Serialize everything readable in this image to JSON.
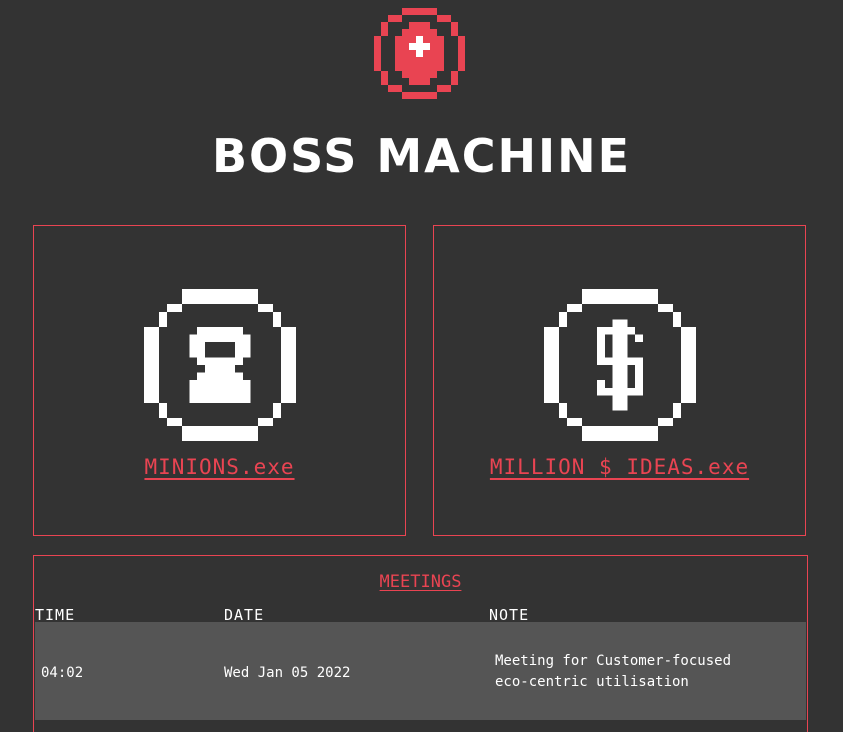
{
  "app": {
    "title": "BOSS MACHINE",
    "logo_icon": "boss-machine-logo-icon",
    "accent_color": "#e94452",
    "background_color": "#333333"
  },
  "cards": [
    {
      "label": "MINIONS.exe",
      "icon": "minion-icon"
    },
    {
      "label": "MILLION $ IDEAS.exe",
      "icon": "dollar-coin-icon"
    }
  ],
  "meetings": {
    "title": "MEETINGS",
    "columns": [
      "TIME",
      "DATE",
      "NOTE"
    ],
    "rows": [
      {
        "time": "04:02",
        "date": "Wed Jan 05 2022",
        "note": "Meeting for Customer-focused\neco-centric utilisation"
      }
    ]
  }
}
